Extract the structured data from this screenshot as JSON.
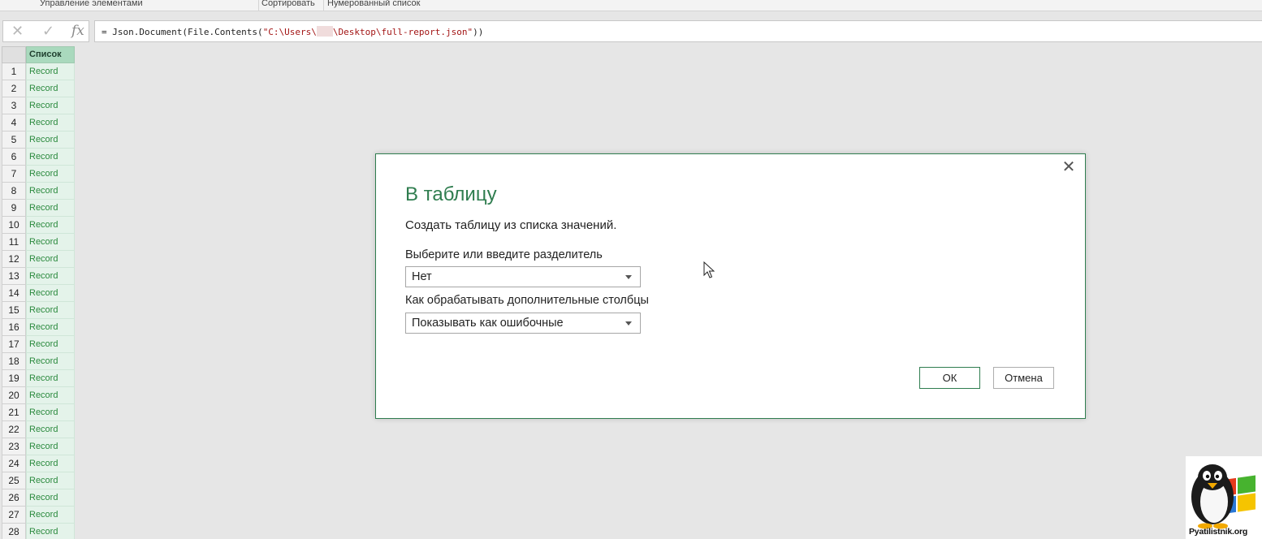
{
  "ribbon": {
    "groups": [
      "Управление элементами",
      "Сортировать",
      "Нумерованный список"
    ]
  },
  "formula_bar": {
    "cancel_icon": "✕",
    "confirm_icon": "✓",
    "fx_icon": "fx",
    "formula_prefix": "= Json.Document(File.Contents(",
    "formula_path_start": "\"C:\\Users\\",
    "formula_path_end": "\\Desktop\\full-report.json\"",
    "formula_suffix": "))"
  },
  "grid": {
    "column_header": "Список",
    "rows": [
      {
        "num": "1",
        "value": "Record"
      },
      {
        "num": "2",
        "value": "Record"
      },
      {
        "num": "3",
        "value": "Record"
      },
      {
        "num": "4",
        "value": "Record"
      },
      {
        "num": "5",
        "value": "Record"
      },
      {
        "num": "6",
        "value": "Record"
      },
      {
        "num": "7",
        "value": "Record"
      },
      {
        "num": "8",
        "value": "Record"
      },
      {
        "num": "9",
        "value": "Record"
      },
      {
        "num": "10",
        "value": "Record"
      },
      {
        "num": "11",
        "value": "Record"
      },
      {
        "num": "12",
        "value": "Record"
      },
      {
        "num": "13",
        "value": "Record"
      },
      {
        "num": "14",
        "value": "Record"
      },
      {
        "num": "15",
        "value": "Record"
      },
      {
        "num": "16",
        "value": "Record"
      },
      {
        "num": "17",
        "value": "Record"
      },
      {
        "num": "18",
        "value": "Record"
      },
      {
        "num": "19",
        "value": "Record"
      },
      {
        "num": "20",
        "value": "Record"
      },
      {
        "num": "21",
        "value": "Record"
      },
      {
        "num": "22",
        "value": "Record"
      },
      {
        "num": "23",
        "value": "Record"
      },
      {
        "num": "24",
        "value": "Record"
      },
      {
        "num": "25",
        "value": "Record"
      },
      {
        "num": "26",
        "value": "Record"
      },
      {
        "num": "27",
        "value": "Record"
      },
      {
        "num": "28",
        "value": "Record"
      }
    ]
  },
  "dialog": {
    "title": "В таблицу",
    "description": "Создать таблицу из списка значений.",
    "delimiter_label": "Выберите или введите разделитель",
    "delimiter_value": "Нет",
    "extra_columns_label": "Как обрабатывать дополнительные столбцы",
    "extra_columns_value": "Показывать как ошибочные",
    "ok_label": "ОК",
    "cancel_label": "Отмена",
    "close_icon": "✕"
  },
  "watermark": {
    "text": "Pyatilistnik.org"
  },
  "colors": {
    "accent": "#2f7d4f",
    "column_header_bg": "#a9d9bd",
    "record_text": "#2b8a3e",
    "cell_bg": "#e4f3ea"
  }
}
